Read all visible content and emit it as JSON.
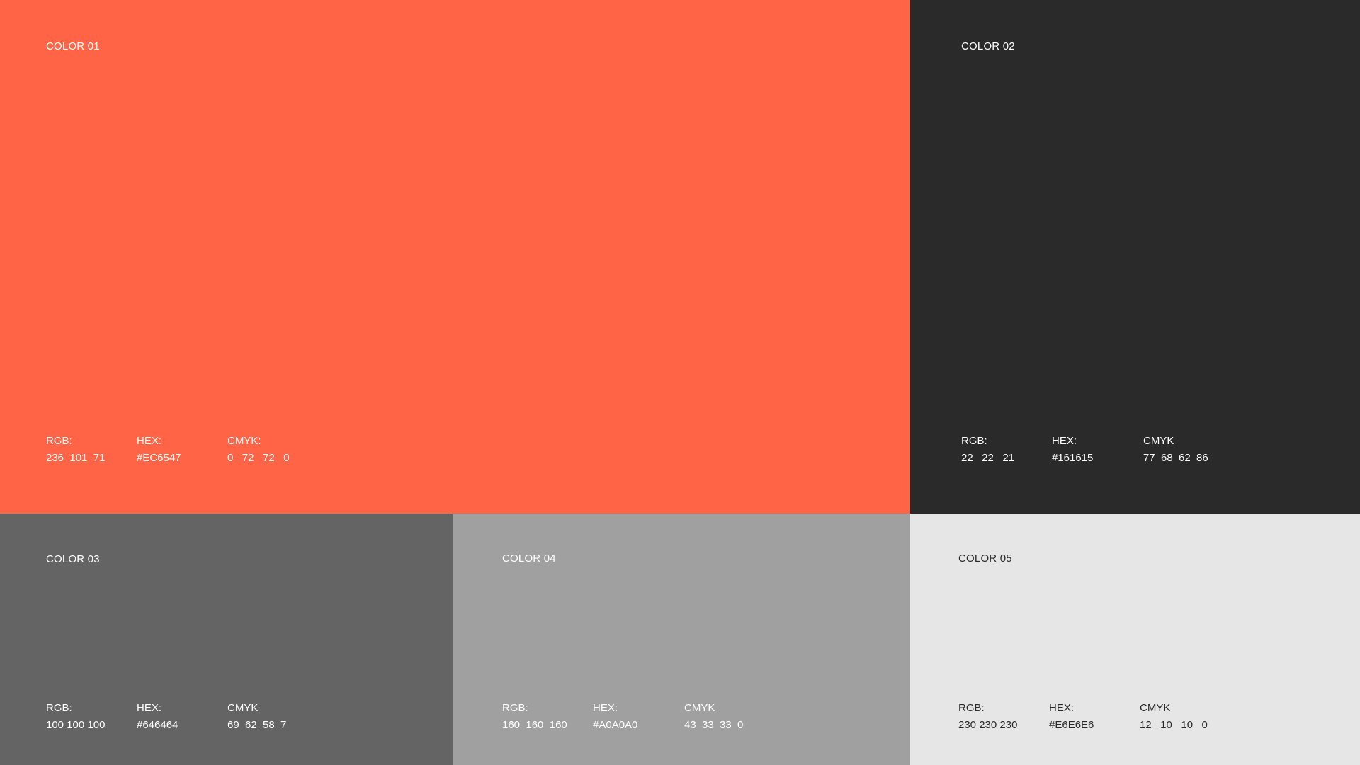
{
  "swatches": [
    {
      "name": "COLOR 01",
      "fill": "#FF6447",
      "text_color": "light",
      "rgb_label": "RGB:",
      "rgb_value": "236  101  71",
      "hex_label": "HEX:",
      "hex_value": "#EC6547",
      "cmyk_label": "CMYK:",
      "cmyk_value": "0   72   72   0"
    },
    {
      "name": "COLOR 02",
      "fill": "#2A2A2A",
      "text_color": "light",
      "rgb_label": "RGB:",
      "rgb_value": "22   22   21",
      "hex_label": "HEX:",
      "hex_value": "#161615",
      "cmyk_label": "CMYK",
      "cmyk_value": "77  68  62  86"
    },
    {
      "name": "COLOR 03",
      "fill": "#646464",
      "text_color": "light",
      "rgb_label": "RGB:",
      "rgb_value": "100 100 100",
      "hex_label": "HEX:",
      "hex_value": "#646464",
      "cmyk_label": "CMYK",
      "cmyk_value": "69  62  58  7"
    },
    {
      "name": "COLOR 04",
      "fill": "#A0A0A0",
      "text_color": "light",
      "rgb_label": "RGB:",
      "rgb_value": "160  160  160",
      "hex_label": "HEX:",
      "hex_value": "#A0A0A0",
      "cmyk_label": "CMYK",
      "cmyk_value": "43  33  33  0"
    },
    {
      "name": "COLOR 05",
      "fill": "#E6E6E6",
      "text_color": "dark",
      "rgb_label": "RGB:",
      "rgb_value": "230 230 230",
      "hex_label": "HEX:",
      "hex_value": "#E6E6E6",
      "cmyk_label": "CMYK",
      "cmyk_value": "12   10   10   0"
    }
  ]
}
